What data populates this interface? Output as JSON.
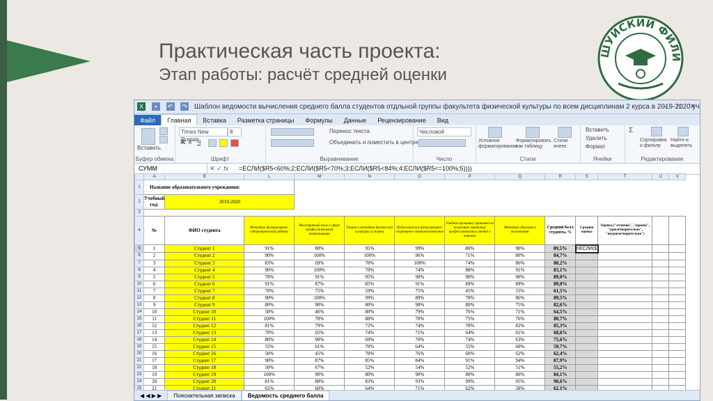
{
  "slide": {
    "title": "Практическая часть проекта:",
    "subtitle": "Этап работы: расчёт средней оценки",
    "logo_text": "ШУЙСКИЙ ФИЛИАЛ ИвГУ",
    "accent": "#3a7a4c"
  },
  "excel": {
    "window_title": "Шаблон ведомости вычисления среднего балла студентов отдльной группы факультета физической культуры по всем дисциплинам 2 курса в 2019-2020 уч.г...",
    "tabs": [
      "Файл",
      "Главная",
      "Вставка",
      "Разметка страницы",
      "Формулы",
      "Данные",
      "Рецензирование",
      "Вид"
    ],
    "ribbon": {
      "paste": "Вставить",
      "font_name": "Times New Roman",
      "font_size": "8",
      "wrap_text": "Перенос текста",
      "merge": "Объединить и поместить в центре",
      "number_format": "Числовой",
      "cond_format": "Условное форматирование",
      "format_table": "Форматировать как таблицу",
      "cell_styles": "Стили ячеек",
      "insert": "Вставить",
      "delete": "Удалить",
      "format": "Формат",
      "sort": "Сортировка и фильтр",
      "find": "Найти и выделить",
      "groups": [
        "Буфер обмена",
        "Шрифт",
        "Выравнивание",
        "Число",
        "Стили",
        "Ячейки",
        "Редактирование"
      ]
    },
    "name_box": "СУММ",
    "formula": "=ЕСЛИ($R5<60%;2;ЕСЛИ($R5<70%;3;ЕСЛИ($R5<84%;4;ЕСЛИ($R5<=100%;5))))",
    "columns": [
      "A",
      "B",
      "L",
      "M",
      "N",
      "O",
      "P",
      "Q",
      "R",
      "S",
      "T",
      "U",
      "V"
    ],
    "header": {
      "institution": "Название образовательного учреждения:",
      "year_label": "Учебный год:",
      "year": "2019-2020",
      "num": "№",
      "name": "ФИО студента",
      "subjects": [
        "Методика физкультурно-оздоровительной работы",
        "Иностранный язык в сфере профессиональной коммуникации",
        "Теория и методика физической культуры и спорта",
        "Педагогическое физкультурно-спортивное совершенствование",
        "Учебная практика, практика по получению первичных профессиональных умений и навыков",
        "Методика обучения и воспитания"
      ],
      "avg": "Средний балл студента, %",
      "grade": "Средняя оценка",
      "grade_text": "Оценка (\"отлично\", \"хорошо\", \"удовлетворительно\", \"неудовлетворительно\")"
    },
    "rows": [
      {
        "r": "5",
        "n": "1",
        "name": "Студент 1",
        "v": [
          "91%",
          "80%",
          "95%",
          "99%",
          "80%",
          "90%"
        ],
        "avg": "89,5%",
        "s": "=ЕСЛИ($"
      },
      {
        "r": "6",
        "n": "2",
        "name": "Студент 2",
        "v": [
          "90%",
          "100%",
          "100%",
          "96%",
          "71%",
          "80%"
        ],
        "avg": "84,7%",
        "s": ""
      },
      {
        "r": "7",
        "n": "3",
        "name": "Студент 3",
        "v": [
          "83%",
          "69%",
          "70%",
          "100%",
          "74%",
          "86%"
        ],
        "avg": "80,2%",
        "s": ""
      },
      {
        "r": "8",
        "n": "4",
        "name": "Студент 4",
        "v": [
          "90%",
          "100%",
          "70%",
          "74%",
          "88%",
          "91%"
        ],
        "avg": "83,1%",
        "s": ""
      },
      {
        "r": "9",
        "n": "5",
        "name": "Студент 5",
        "v": [
          "78%",
          "91%",
          "95%",
          "90%",
          "90%",
          "90%"
        ],
        "avg": "89,0%",
        "s": ""
      },
      {
        "r": "10",
        "n": "6",
        "name": "Студент 6",
        "v": [
          "91%",
          "87%",
          "85%",
          "91%",
          "89%",
          "89%"
        ],
        "avg": "89,0%",
        "s": ""
      },
      {
        "r": "11",
        "n": "7",
        "name": "Студент 7",
        "v": [
          "70%",
          "75%",
          "59%",
          "75%",
          "45%",
          "55%"
        ],
        "avg": "61,5%",
        "s": ""
      },
      {
        "r": "12",
        "n": "8",
        "name": "Студент 8",
        "v": [
          "90%",
          "100%",
          "99%",
          "89%",
          "78%",
          "86%"
        ],
        "avg": "89,5%",
        "s": ""
      },
      {
        "r": "13",
        "n": "9",
        "name": "Студент 9",
        "v": [
          "80%",
          "90%",
          "80%",
          "90%",
          "80%",
          "75%"
        ],
        "avg": "82,6%",
        "s": ""
      },
      {
        "r": "14",
        "n": "10",
        "name": "Студент 10",
        "v": [
          "58%",
          "46%",
          "80%",
          "79%",
          "76%",
          "71%"
        ],
        "avg": "64,5%",
        "s": ""
      },
      {
        "r": "15",
        "n": "11",
        "name": "Студент 11",
        "v": [
          "100%",
          "78%",
          "88%",
          "70%",
          "75%",
          "76%"
        ],
        "avg": "80,7%",
        "s": ""
      },
      {
        "r": "16",
        "n": "12",
        "name": "Студент 12",
        "v": [
          "81%",
          "79%",
          "72%",
          "74%",
          "78%",
          "82%"
        ],
        "avg": "85,3%",
        "s": ""
      },
      {
        "r": "17",
        "n": "13",
        "name": "Студент 13",
        "v": [
          "70%",
          "65%",
          "74%",
          "71%",
          "64%",
          "61%"
        ],
        "avg": "68,6%",
        "s": ""
      },
      {
        "r": "18",
        "n": "14",
        "name": "Студент 14",
        "v": [
          "80%",
          "90%",
          "69%",
          "70%",
          "74%",
          "63%"
        ],
        "avg": "75,6%",
        "s": ""
      },
      {
        "r": "19",
        "n": "15",
        "name": "Студент 15",
        "v": [
          "55%",
          "61%",
          "70%",
          "64%",
          "55%",
          "60%"
        ],
        "avg": "59,7%",
        "s": ""
      },
      {
        "r": "20",
        "n": "16",
        "name": "Студент 16",
        "v": [
          "50%",
          "45%",
          "70%",
          "76%",
          "60%",
          "62%"
        ],
        "avg": "62,4%",
        "s": ""
      },
      {
        "r": "21",
        "n": "17",
        "name": "Студент 17",
        "v": [
          "90%",
          "87%",
          "85%",
          "84%",
          "91%",
          "94%"
        ],
        "avg": "87,9%",
        "s": ""
      },
      {
        "r": "22",
        "n": "18",
        "name": "Студент 18",
        "v": [
          "50%",
          "67%",
          "52%",
          "54%",
          "52%",
          "51%"
        ],
        "avg": "55,2%",
        "s": ""
      },
      {
        "r": "23",
        "n": "19",
        "name": "Студент 19",
        "v": [
          "100%",
          "90%",
          "80%",
          "90%",
          "80%",
          "80%"
        ],
        "avg": "84,1%",
        "s": ""
      },
      {
        "r": "24",
        "n": "20",
        "name": "Студент 20",
        "v": [
          "81%",
          "88%",
          "83%",
          "93%",
          "99%",
          "95%"
        ],
        "avg": "90,6%",
        "s": ""
      },
      {
        "r": "25",
        "n": "21",
        "name": "Студент 21",
        "v": [
          "65%",
          "60%",
          "64%",
          "71%",
          "62%",
          "58%"
        ],
        "avg": "62,1%",
        "s": ""
      },
      {
        "r": "26",
        "n": "22",
        "name": "Студент 22",
        "v": [
          "79%",
          "62%",
          "74%",
          "81%",
          "81%",
          "92%"
        ],
        "avg": "77,3%",
        "s": ""
      },
      {
        "r": "27",
        "n": "23",
        "name": "Студент 23",
        "v": [
          "77%",
          "80%",
          "91%",
          "98%",
          "96%",
          "80%"
        ],
        "avg": "88,6%",
        "s": ""
      }
    ],
    "sheet_tabs": [
      "Пояснительная записка",
      "Ведомость среднего балла"
    ]
  }
}
